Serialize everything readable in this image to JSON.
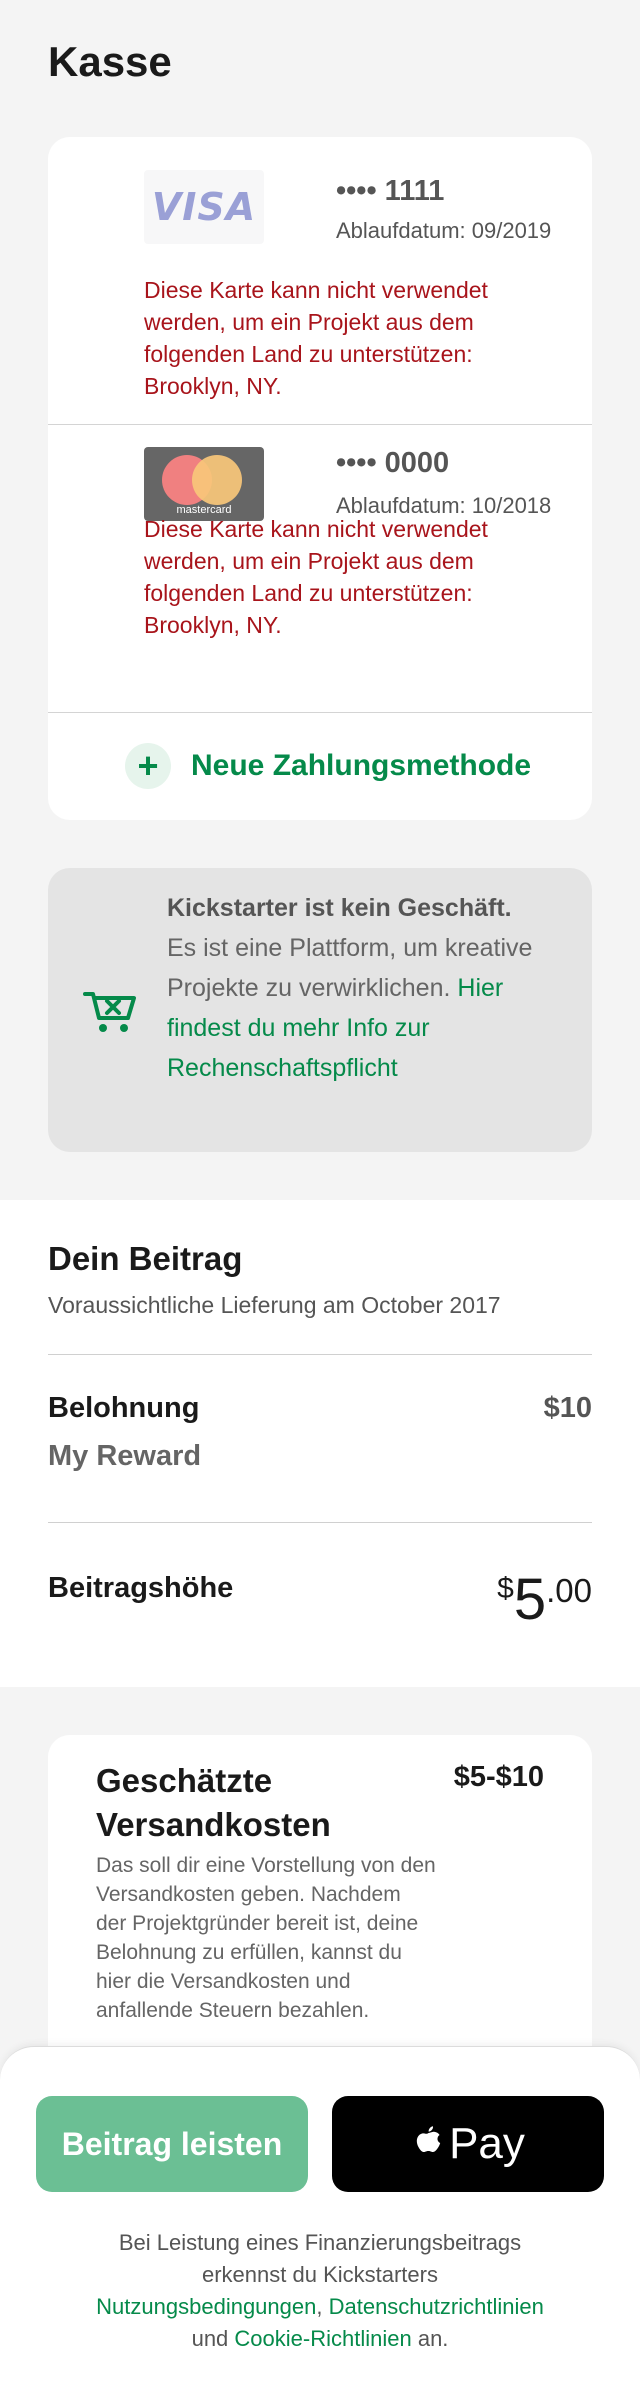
{
  "header": {
    "title": "Kasse"
  },
  "cards": [
    {
      "brand": "VISA",
      "number": "•••• 1111",
      "expiry": "Ablaufdatum: 09/2019",
      "error": "Diese Karte kann nicht verwendet werden, um ein Projekt aus dem folgenden Land zu unterstützen: Brooklyn, NY."
    },
    {
      "brand": "mastercard",
      "number": "•••• 0000",
      "expiry": "Ablaufdatum: 10/2018",
      "error": "Diese Karte kann nicht verwendet werden, um ein Projekt aus dem folgenden Land zu unterstützen: Brooklyn, NY."
    }
  ],
  "add_payment": {
    "icon": "plus-icon",
    "label": "Neue Zahlungsmethode"
  },
  "info": {
    "icon": "cart-x-icon",
    "bold": "Kickstarter ist kein Geschäft.",
    "text": " Es ist eine Plattform, um kreative Projekte zu verwirklichen. ",
    "link": "Hier findest du mehr Info zur Rechenschaftspflicht"
  },
  "contribution": {
    "title": "Dein Beitrag",
    "delivery": "Voraussichtliche Lieferung am October 2017",
    "reward_label": "Belohnung",
    "reward_price": "$10",
    "reward_name": "My Reward",
    "amount_label": "Beitragshöhe",
    "amount_currency": "$",
    "amount_integer": "5",
    "amount_decimal": ".00"
  },
  "shipping": {
    "title": "Geschätzte Versandkosten",
    "price": "$5-$10",
    "description": "Das soll dir eine Vorstellung von den Versandkosten geben. Nachdem der Projektgründer bereit ist, deine Belohnung zu erfüllen, kannst du hier die Versandkosten und anfallende Steuern bezahlen."
  },
  "footer": {
    "contribute_button": "Beitrag leisten",
    "apple_pay_label": "Pay",
    "apple_icon": "apple-icon",
    "legal_prefix": "Bei Leistung eines Finanzierungsbeitrags erkennst du Kickstarters ",
    "legal_terms": "Nutzungsbedingungen",
    "legal_sep1": ", ",
    "legal_privacy": "Datenschutzrichtlinien",
    "legal_and": " und ",
    "legal_cookie": "Cookie-Richtlinien",
    "legal_suffix": " an."
  },
  "colors": {
    "accent": "#058a4a",
    "error": "#a8141b",
    "contribute_button": "#6bbf94"
  }
}
